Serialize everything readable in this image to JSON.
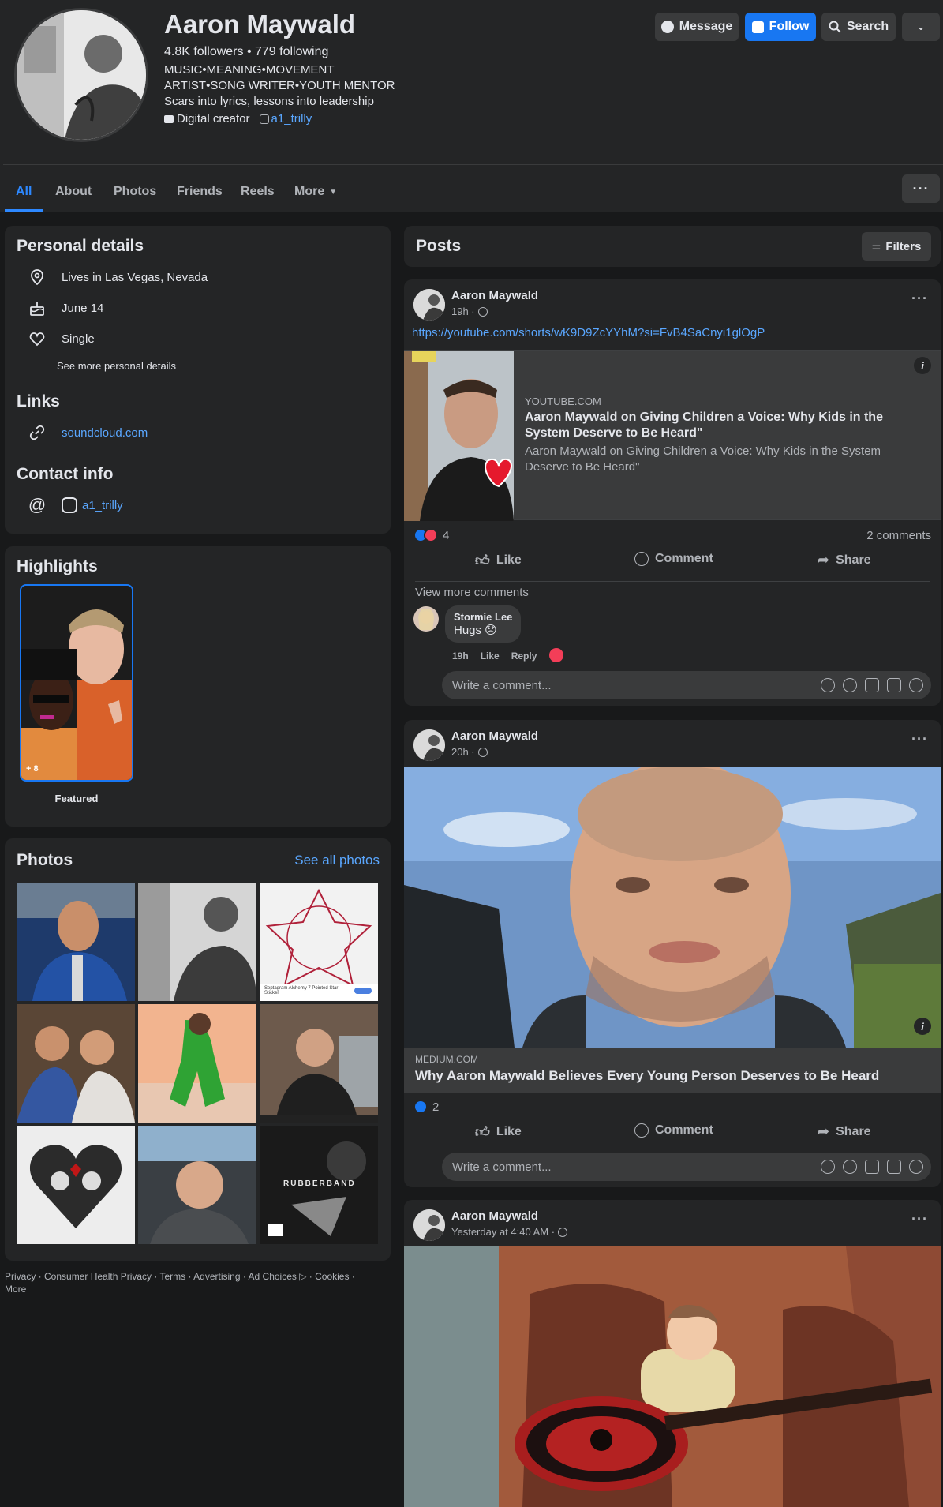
{
  "profile": {
    "name": "Aaron Maywald",
    "followers_line": "4.8K followers • 779 following",
    "bio": [
      "MUSIC•MEANING•MOVEMENT",
      "ARTIST•SONG WRITER•YOUTH MENTOR",
      "Scars into lyrics, lessons into leadership"
    ],
    "category": "Digital creator",
    "instagram_handle": "a1_trilly"
  },
  "header_buttons": {
    "message": "Message",
    "follow": "Follow",
    "search": "Search"
  },
  "tabs": [
    {
      "label": "All",
      "active": true
    },
    {
      "label": "About"
    },
    {
      "label": "Photos"
    },
    {
      "label": "Friends"
    },
    {
      "label": "Reels"
    },
    {
      "label": "More"
    }
  ],
  "personal_details": {
    "title": "Personal details",
    "location": "Lives in Las Vegas, Nevada",
    "birthday": "June 14",
    "relationship": "Single",
    "see_more": "See more personal details"
  },
  "links": {
    "title": "Links",
    "soundcloud": "soundcloud.com"
  },
  "contact": {
    "title": "Contact info",
    "instagram": "a1_trilly"
  },
  "highlights": {
    "title": "Highlights",
    "count_badge": "+ 8",
    "featured_label": "Featured"
  },
  "photos": {
    "title": "Photos",
    "see_all": "See all photos",
    "tile_texts": {
      "sticker_caption": "Septagram Alchemy 7 Pointed Star Sticker",
      "album_title": "RUBBERBAND"
    }
  },
  "footer": {
    "line1": "Privacy · Consumer Health Privacy · Terms · Advertising · Ad Choices ▷ · Cookies ·",
    "line2": "More"
  },
  "posts_header": {
    "title": "Posts",
    "filters": "Filters"
  },
  "posts": [
    {
      "author": "Aaron Maywald",
      "time": "19h ·",
      "url": "https://youtube.com/shorts/wK9D9ZcYYhM?si=FvB4SaCnyi1glOgP",
      "link_domain": "YOUTUBE.COM",
      "link_title": "Aaron Maywald on Giving Children a Voice: Why Kids in the System Deserve to Be Heard\"",
      "link_desc": "Aaron Maywald on Giving Children a Voice: Why Kids in the System Deserve to Be Heard\"",
      "reactions": "4",
      "comments_count": "2 comments",
      "view_more": "View more comments",
      "comment": {
        "author": "Stormie Lee",
        "text": "Hugs 😞",
        "time": "19h",
        "like": "Like",
        "reply": "Reply"
      }
    },
    {
      "author": "Aaron Maywald",
      "time": "20h ·",
      "link_domain": "MEDIUM.COM",
      "link_title": "Why Aaron Maywald Believes Every Young Person Deserves to Be Heard",
      "reactions": "2"
    },
    {
      "author": "Aaron Maywald",
      "time": "Yesterday at 4:40 AM ·"
    }
  ],
  "post_actions": {
    "like": "Like",
    "comment": "Comment",
    "share": "Share",
    "write_comment": "Write a comment..."
  }
}
